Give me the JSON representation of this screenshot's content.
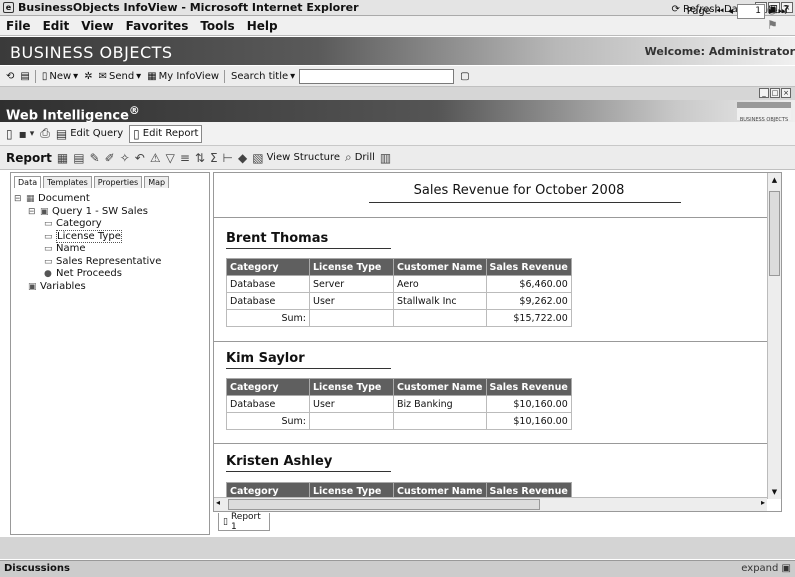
{
  "window": {
    "title": "BusinessObjects InfoView - Microsoft Internet Explorer"
  },
  "menu": [
    "File",
    "Edit",
    "View",
    "Favorites",
    "Tools",
    "Help"
  ],
  "infoview": {
    "logo": "BUSINESS OBJECTS",
    "welcome": "Welcome: Administrator",
    "toolbar": {
      "new": "New",
      "send": "Send",
      "my_infoview": "My InfoView",
      "search_title": "Search title"
    }
  },
  "webi": {
    "title": "Web Intelligence",
    "logo_small": "BUSINESS OBJECTS",
    "edit_query": "Edit Query",
    "edit_report": "Edit Report",
    "refresh_data": "Refresh Data",
    "report_label": "Report",
    "view_structure": "View Structure",
    "drill": "Drill",
    "page_label": "Page",
    "page_number": "1"
  },
  "left_tabs": [
    "Data",
    "Templates",
    "Properties",
    "Map"
  ],
  "tree": {
    "document": "Document",
    "query": "Query 1 - SW Sales",
    "objects": [
      "Category",
      "License Type",
      "Name",
      "Sales Representative",
      "Net Proceeds"
    ],
    "variables": "Variables"
  },
  "report": {
    "title": "Sales Revenue for October 2008",
    "columns": [
      "Category",
      "License Type",
      "Customer Name",
      "Sales Revenue"
    ],
    "sum_label": "Sum:",
    "sections": [
      {
        "name": "Brent Thomas",
        "rows": [
          [
            "Database",
            "Server",
            "Aero",
            "$6,460.00"
          ],
          [
            "Database",
            "User",
            "Stallwalk Inc",
            "$9,262.00"
          ]
        ],
        "sum": "$15,722.00"
      },
      {
        "name": "Kim Saylor",
        "rows": [
          [
            "Database",
            "User",
            "Biz Banking",
            "$10,160.00"
          ]
        ],
        "sum": "$10,160.00"
      },
      {
        "name": "Kristen Ashley",
        "rows": [],
        "sum": ""
      }
    ],
    "tab": "Report 1"
  },
  "status": {
    "left": "Discussions",
    "right": "expand"
  }
}
